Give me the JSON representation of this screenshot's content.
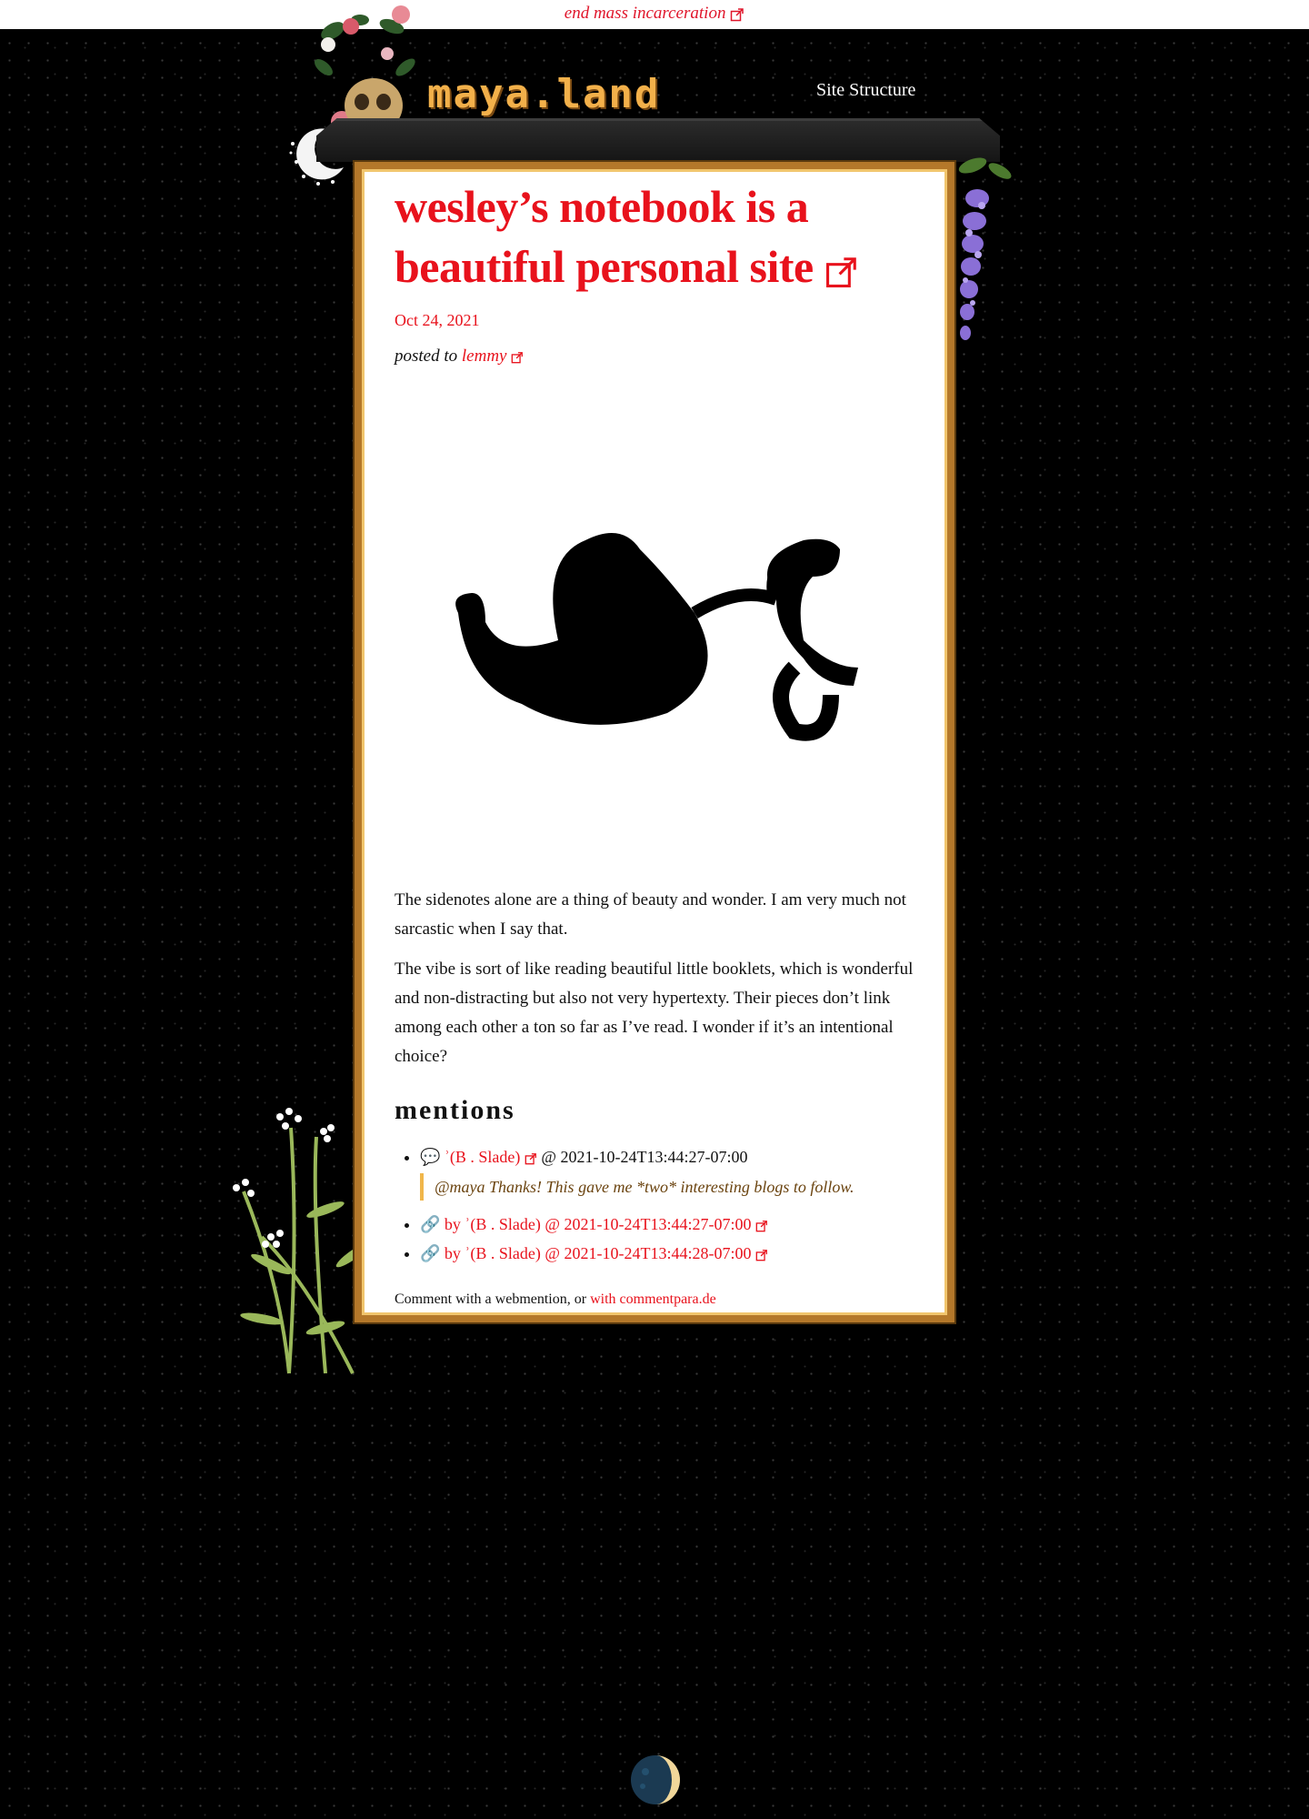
{
  "banner": {
    "text": "end mass incarceration"
  },
  "header": {
    "logo_text": "maya.land",
    "nav_link": "Site Structure"
  },
  "post": {
    "title": "wesley’s notebook is a beautiful personal site",
    "date": "Oct 24, 2021",
    "posted_prefix": "posted to",
    "posted_target": "lemmy",
    "paragraphs": [
      "The sidenotes alone are a thing of beauty and wonder. I am very much not sarcastic when I say that.",
      "The vibe is sort of like reading beautiful little booklets, which is wonderful and non-distracting but also not very hypertexty. Their pieces don’t link among each other a ton so far as I’ve read. I wonder if it’s an intentional choice?"
    ]
  },
  "mentions": {
    "heading": "mentions",
    "items": [
      {
        "icon": "💬",
        "author": "ʾ(B . Slade)",
        "sep": "@",
        "time": "2021-10-24T13:44:27-07:00",
        "quote": "@maya Thanks! This gave me *two* interesting blogs to follow."
      },
      {
        "icon": "🔗",
        "by": "by ʾ(B . Slade)",
        "sep": "@",
        "time": "2021-10-24T13:44:27-07:00"
      },
      {
        "icon": "🔗",
        "by": "by ʾ(B . Slade)",
        "sep": "@",
        "time": "2021-10-24T13:44:28-07:00"
      }
    ]
  },
  "comment": {
    "prefix": "Comment with a webmention, or",
    "link": "with commentpara.de"
  },
  "icons": [
    "external-link-icon",
    "speech-bubble-icon",
    "link-icon",
    "leaf-icon",
    "moon-icon",
    "skull-icon",
    "rose-icon",
    "wisteria-icon",
    "yarrow-flower-icon"
  ],
  "colors": {
    "accent": "#e8121c",
    "gold": "#b4782a",
    "quote_border": "#f0b64b",
    "background": "#000000"
  }
}
